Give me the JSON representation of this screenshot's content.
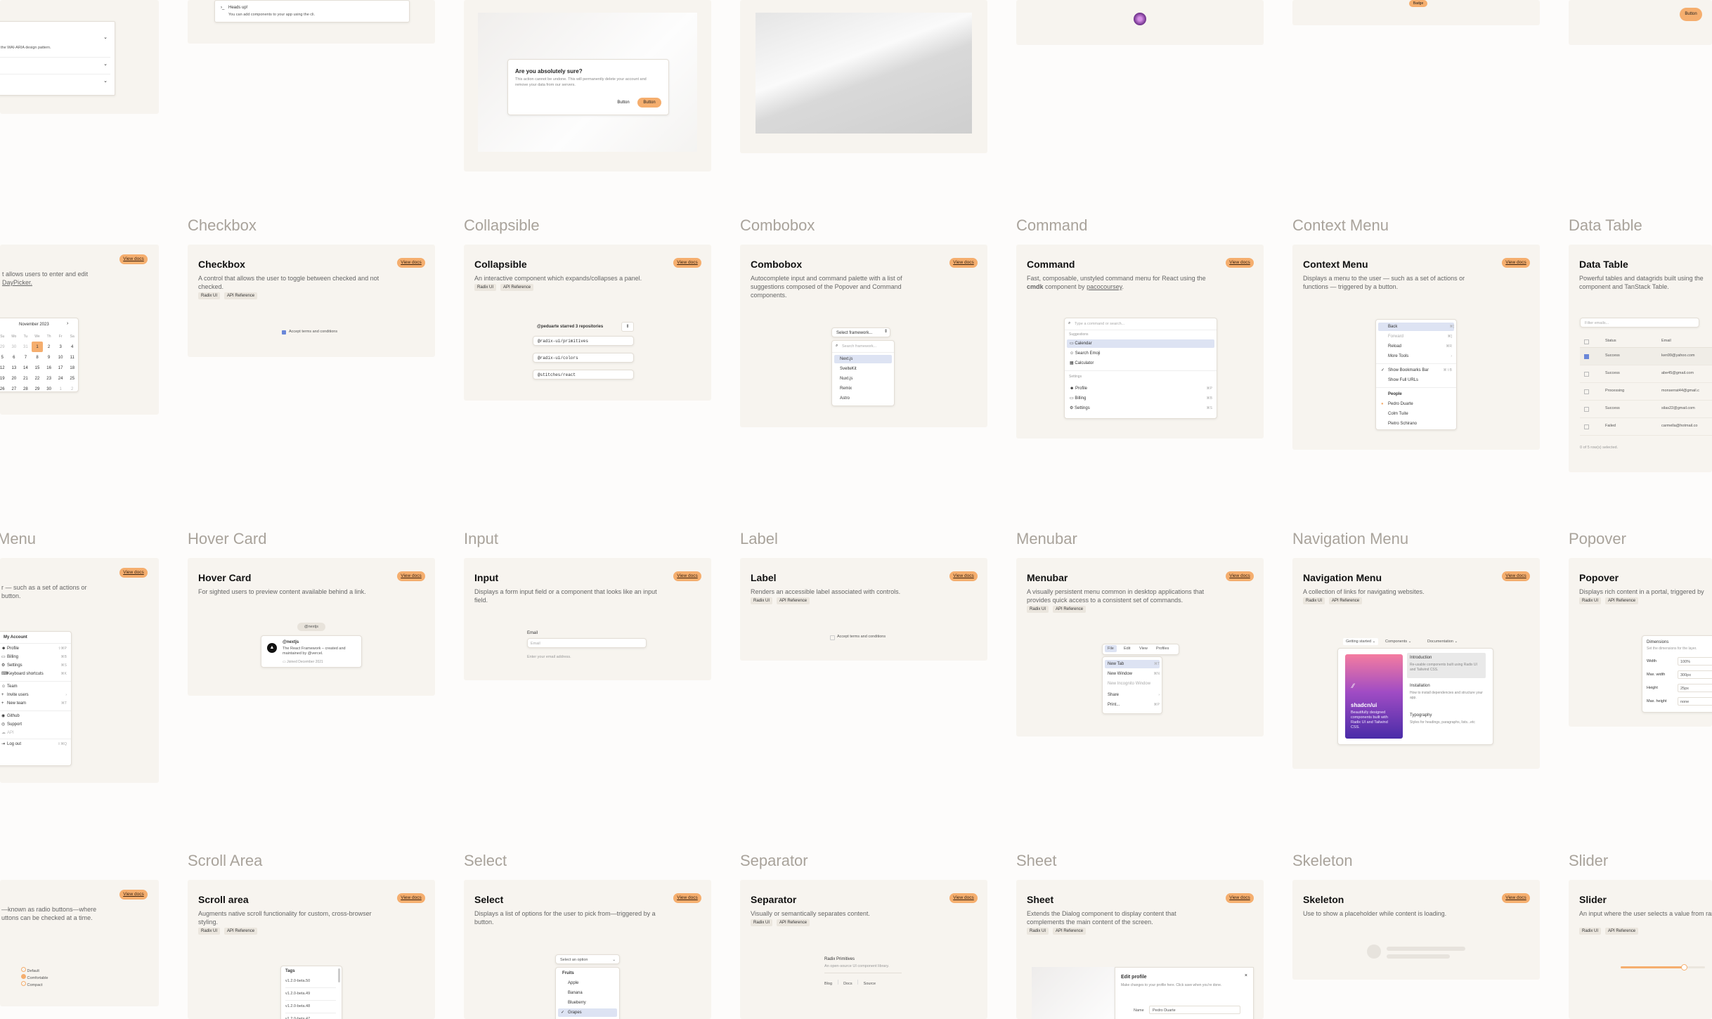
{
  "sections": {
    "checkbox": "Checkbox",
    "collapsible": "Collapsible",
    "combobox": "Combobox",
    "command": "Command",
    "context_menu": "Context Menu",
    "data_table": "Data Table",
    "menu": "Menu",
    "hover_card": "Hover Card",
    "input": "Input",
    "label": "Label",
    "menubar": "Menubar",
    "navigation_menu": "Navigation Menu",
    "popover": "Popover",
    "scroll_area": "Scroll Area",
    "select": "Select",
    "separator": "Separator",
    "sheet": "Sheet",
    "skeleton": "Skeleton",
    "slider": "Slider"
  },
  "common": {
    "view_docs": "View docs",
    "radix_ui": "Radix UI",
    "api_ref": "API Reference"
  },
  "accordion": {
    "desc": "the WAI-ARIA design pattern."
  },
  "alert": {
    "title": "Heads up!",
    "desc": "You can add components to your app using the cli."
  },
  "alert_dialog": {
    "title": "Are you absolutely sure?",
    "desc": "This action cannot be undone. This will permanently delete your account and remove your data from our servers.",
    "cancel": "Button",
    "confirm": "Button"
  },
  "badge": {
    "label": "Badge"
  },
  "button": {
    "label": "Button"
  },
  "date_picker": {
    "desc1": "t allows users to enter and edit",
    "desc2": "DayPicker.",
    "month": "November 2023",
    "days": [
      "Su",
      "Mo",
      "Tu",
      "We",
      "Th",
      "Fr",
      "Sa"
    ],
    "weeks": [
      [
        "29",
        "30",
        "31",
        "1",
        "2",
        "3",
        "4"
      ],
      [
        "5",
        "6",
        "7",
        "8",
        "9",
        "10",
        "11"
      ],
      [
        "12",
        "13",
        "14",
        "15",
        "16",
        "17",
        "18"
      ],
      [
        "19",
        "20",
        "21",
        "22",
        "23",
        "24",
        "25"
      ],
      [
        "26",
        "27",
        "28",
        "29",
        "30",
        "1",
        "2"
      ]
    ]
  },
  "checkbox": {
    "title": "Checkbox",
    "desc": "A control that allows the user to toggle between checked and not checked.",
    "label": "Accept terms and conditions"
  },
  "collapsible": {
    "title": "Collapsible",
    "desc": "An interactive component which expands/collapses a panel.",
    "header": "@peduarte starred 3 repositories",
    "items": [
      "@radix-ui/primitives",
      "@radix-ui/colors",
      "@stitches/react"
    ]
  },
  "combobox": {
    "title": "Combobox",
    "desc": "Autocomplete input and command palette with a list of suggestions composed of the Popover and Command components.",
    "trigger": "Select framework...",
    "search": "Search framework...",
    "items": [
      "Next.js",
      "SvelteKit",
      "Nuxt.js",
      "Remix",
      "Astro"
    ]
  },
  "command": {
    "title": "Command",
    "desc1": "Fast, composable, unstyled command menu for React using the ",
    "desc_cmdk": "cmdk",
    "desc2": " component by ",
    "desc_author": "pacocoursey",
    "desc3": ".",
    "placeholder": "Type a command or search...",
    "group1": "Suggestions",
    "items1": [
      "Calendar",
      "Search Emoji",
      "Calculator"
    ],
    "group2": "Settings",
    "items2": [
      {
        "label": "Profile",
        "kbd": "⌘P"
      },
      {
        "label": "Billing",
        "kbd": "⌘B"
      },
      {
        "label": "Settings",
        "kbd": "⌘S"
      }
    ]
  },
  "context_menu": {
    "title": "Context Menu",
    "desc": "Displays a menu to the user — such as a set of actions or functions — triggered by a button.",
    "items": [
      {
        "label": "Back",
        "kbd": "⌘["
      },
      {
        "label": "Forward",
        "kbd": "⌘]"
      },
      {
        "label": "Reload",
        "kbd": "⌘R"
      },
      {
        "label": "More Tools",
        "kbd": "›"
      }
    ],
    "checks": [
      {
        "label": "Show Bookmarks Bar",
        "kbd": "⌘⇧B"
      },
      {
        "label": "Show Full URLs",
        "kbd": ""
      }
    ],
    "people_label": "People",
    "people": [
      "Pedro Duarte",
      "Colm Tuite",
      "Pietro Schirano"
    ]
  },
  "data_table": {
    "title": "Data Table",
    "desc": "Powerful tables and datagrids built using the component and TanStack Table.",
    "filter": "Filter emails...",
    "col_status": "Status",
    "col_email": "Email",
    "rows": [
      {
        "status": "Success",
        "email": "ken99@yahoo.com"
      },
      {
        "status": "Success",
        "email": "abe45@gmail.com"
      },
      {
        "status": "Processing",
        "email": "monserrat44@gmail.c"
      },
      {
        "status": "Success",
        "email": "silas22@gmail.com"
      },
      {
        "status": "Failed",
        "email": "carmella@hotmail.co"
      }
    ],
    "footer": "0 of 5 row(s) selected."
  },
  "dropdown": {
    "desc1": "r — such as a set of actions or",
    "desc2": "button.",
    "header": "My Account",
    "g1": [
      {
        "label": "Profile",
        "kbd": "⇧⌘P"
      },
      {
        "label": "Billing",
        "kbd": "⌘B"
      },
      {
        "label": "Settings",
        "kbd": "⌘S"
      },
      {
        "label": "Keyboard shortcuts",
        "kbd": "⌘K"
      }
    ],
    "g2": [
      {
        "label": "Team",
        "kbd": ""
      },
      {
        "label": "Invite users",
        "kbd": "›"
      },
      {
        "label": "New team",
        "kbd": "⌘T"
      }
    ],
    "g3": [
      {
        "label": "Github",
        "kbd": ""
      },
      {
        "label": "Support",
        "kbd": ""
      },
      {
        "label": "API",
        "kbd": ""
      }
    ],
    "logout": "Log out",
    "logout_kbd": "⇧⌘Q"
  },
  "hover_card": {
    "title": "Hover Card",
    "desc": "For sighted users to preview content available behind a link.",
    "trigger": "@nextjs",
    "name": "@nextjs",
    "bio": "The React Framework – created and maintained by @vercel.",
    "joined": "Joined December 2021"
  },
  "input": {
    "title": "Input",
    "desc": "Displays a form input field or a component that looks like an input field.",
    "label": "Email",
    "placeholder": "Email",
    "hint": "Enter your email address."
  },
  "label": {
    "title": "Label",
    "desc": "Renders an accessible label associated with controls.",
    "text": "Accept terms and conditions"
  },
  "menubar": {
    "title": "Menubar",
    "desc": "A visually persistent menu common in desktop applications that provides quick access to a consistent set of commands.",
    "menus": [
      "File",
      "Edit",
      "View",
      "Profiles"
    ],
    "items": [
      {
        "label": "New Tab",
        "kbd": "⌘T"
      },
      {
        "label": "New Window",
        "kbd": "⌘N"
      },
      {
        "label": "New Incognito Window",
        "kbd": ""
      },
      {
        "label": "Share",
        "kbd": "›"
      },
      {
        "label": "Print...",
        "kbd": "⌘P"
      }
    ]
  },
  "nav_menu": {
    "title": "Navigation Menu",
    "desc": "A collection of links for navigating websites.",
    "links": [
      "Getting started",
      "Components",
      "Documentation"
    ],
    "hero_title": "shadcn/ui",
    "hero_desc": "Beautifully designed components built with Radix UI and Tailwind CSS.",
    "entries": [
      {
        "t": "Introduction",
        "d": "Re-usable components built using Radix UI and Tailwind CSS."
      },
      {
        "t": "Installation",
        "d": "How to install dependencies and structure your app."
      },
      {
        "t": "Typography",
        "d": "Styles for headings, paragraphs, lists...etc"
      }
    ]
  },
  "popover": {
    "title": "Popover",
    "desc": "Displays rich content in a portal, triggered by",
    "heading": "Dimensions",
    "sub": "Set the dimensions for the layer.",
    "fields": [
      {
        "k": "Width",
        "v": "100%"
      },
      {
        "k": "Max. width",
        "v": "300px"
      },
      {
        "k": "Height",
        "v": "25px"
      },
      {
        "k": "Max. height",
        "v": "none"
      }
    ]
  },
  "radio": {
    "desc1": "—known as radio buttons—where",
    "desc2": "uttons can be checked at a time.",
    "options": [
      "Default",
      "Comfortable",
      "Compact"
    ]
  },
  "scroll_area": {
    "title": "Scroll area",
    "desc": "Augments native scroll functionality for custom, cross-browser styling.",
    "header": "Tags",
    "items": [
      "v1.2.0-beta.50",
      "v1.2.0-beta.49",
      "v1.2.0-beta.48",
      "v1.2.0-beta.47"
    ]
  },
  "select": {
    "title": "Select",
    "desc": "Displays a list of options for the user to pick from—triggered by a button.",
    "trigger": "Select an option",
    "group": "Fruits",
    "items": [
      "Apple",
      "Banana",
      "Blueberry",
      "Grapes"
    ]
  },
  "separator": {
    "title": "Separator",
    "desc": "Visually or semantically separates content.",
    "heading": "Radix Primitives",
    "sub": "An open-source UI component library.",
    "links": [
      "Blog",
      "Docs",
      "Source"
    ]
  },
  "sheet": {
    "title": "Sheet",
    "desc": "Extends the Dialog component to display content that complements the main content of the screen.",
    "heading": "Edit profile",
    "sub": "Make changes to your profile here. Click save when you're done.",
    "name_label": "Name",
    "name_value": "Pedro Duarte"
  },
  "skeleton": {
    "title": "Skeleton",
    "desc": "Use to show a placeholder while content is loading."
  },
  "slider": {
    "title": "Slider",
    "desc": "An input where the user selects a value from range.",
    "value": 0.75
  }
}
